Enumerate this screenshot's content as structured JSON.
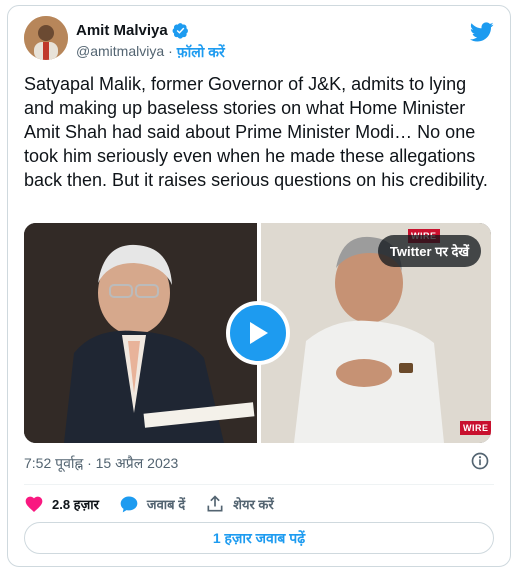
{
  "author": {
    "name": "Amit Malviya",
    "handle": "@amitmalviya",
    "separator": "·",
    "follow_label": "फ़ॉलो करें"
  },
  "tweet": {
    "text": "Satyapal Malik, former Governor of J&K, admits to lying and making up baseless stories on what Home Minister Amit Shah had said about Prime Minister Modi… No one took him seriously even when he made these allegations back then. But it raises serious questions on his credibility."
  },
  "media": {
    "overlay_label": "Twitter पर देखें",
    "brand_top": "WIRE",
    "brand_bottom": "WIRE"
  },
  "timestamp": "7:52 पूर्वाह्न · 15 अप्रैल 2023",
  "actions": {
    "likes_count": "2.8 हज़ार",
    "reply_label": "जवाब दें",
    "share_label": "शेयर करें"
  },
  "read_replies_label": "1 हज़ार जवाब पढ़ें",
  "colors": {
    "accent": "#1d9bf0",
    "like": "#f91880",
    "text": "#0f1419",
    "muted": "#536471",
    "border": "#cfd9de"
  },
  "icons": [
    "verified-badge-icon",
    "twitter-bird-icon",
    "play-icon",
    "info-icon",
    "heart-icon",
    "reply-icon",
    "share-icon"
  ]
}
